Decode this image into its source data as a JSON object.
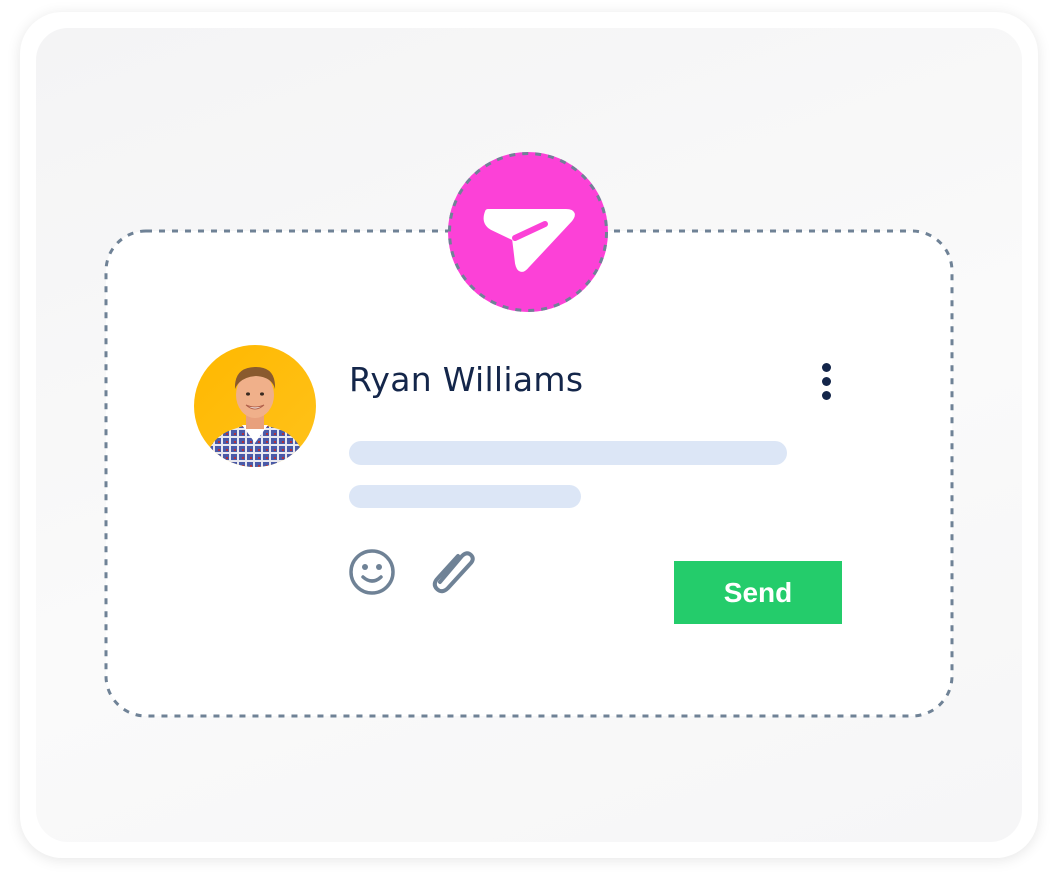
{
  "contact": {
    "name": "Ryan Williams",
    "avatar": "portrait of smiling young man in checked shirt on yellow background"
  },
  "badge": {
    "icon": "send-arrow-icon",
    "color": "#fc41d7"
  },
  "toolbar": {
    "emoji_icon": "smiley-face-icon",
    "attach_icon": "paperclip-icon",
    "more_icon": "vertical-ellipsis-icon"
  },
  "send_button": {
    "label": "Send",
    "color": "#24cc6b"
  },
  "colors": {
    "name_text": "#14264a",
    "placeholder_lines": "#dce6f6",
    "outline": "#6f8296",
    "icons": "#6f8296"
  }
}
